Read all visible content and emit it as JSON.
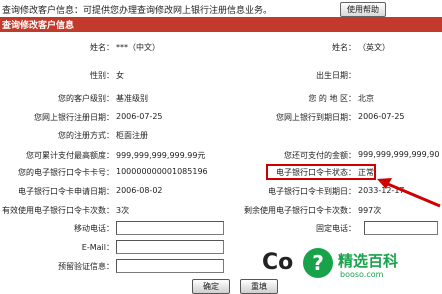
{
  "header": {
    "notice": "查询修改客户信息：可提供您办理查询修改网上银行注册信息业务。",
    "help_button": "使用帮助",
    "section_title": "查询修改客户信息"
  },
  "fields": {
    "name_cn_label": "姓名：",
    "name_cn_value": "***（中文）",
    "name_en_label": "姓名：",
    "name_en_value": "（英文）",
    "gender_label": "性别：",
    "gender_value": "女",
    "birth_label": "出生日期：",
    "birth_value": "",
    "level_label": "您的客户级别：",
    "level_value": "基准级别",
    "region_label": "您 的 地 区：",
    "region_value": "北京",
    "regdate_label": "您网上银行注册日期：",
    "regdate_value": "2006-07-25",
    "expdate_label": "您网上银行到期日期：",
    "expdate_value": "2006-07-25",
    "regmethod_label": "您的注册方式：",
    "regmethod_value": "柜面注册",
    "maxpay_label": "您可累计支付最高额度：",
    "maxpay_value": "999,999,999,999.99元",
    "remainpay_label": "您还可支付的金额：",
    "remainpay_value": "999,999,999,999,90",
    "tokenno_label": "您的电子银行口令卡卡号：",
    "tokenno_value": "100000000001085196",
    "tokenstatus_label": "电子银行口令卡状态：",
    "tokenstatus_value": "正常",
    "tokenapply_label": "电子银行口令卡申请日期：",
    "tokenapply_value": "2006-08-02",
    "tokenexpire_label": "电子银行口令卡到期日：",
    "tokenexpire_value": "2033-12-17",
    "usedcount_label": "有效使用电子银行口令卡次数：",
    "usedcount_value": "3次",
    "remaincount_label": "剩余使用电子银行口令卡次数：",
    "remaincount_value": "997次",
    "mobile_label": "移动电话：",
    "landline_label": "固定电话：",
    "email_label": "E-Mail：",
    "reserve_label": "预留验证信息："
  },
  "buttons": {
    "confirm": "确定",
    "reset": "重填"
  },
  "watermark": {
    "co": "Co",
    "icon": "?",
    "title": "精选百科",
    "url": "booso.com"
  },
  "colors": {
    "title_bar": "#c23a2b",
    "highlight": "#d00000",
    "watermark": "#1aa24c"
  }
}
